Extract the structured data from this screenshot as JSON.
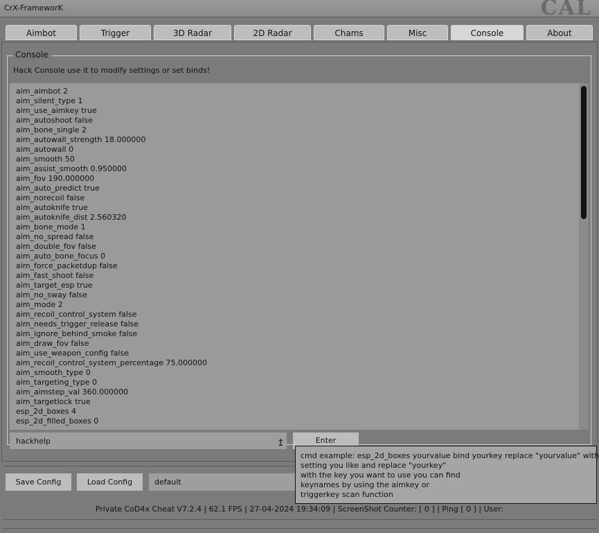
{
  "window": {
    "title": "CrX-FrameworK",
    "logo_text": "CAL"
  },
  "tabs": [
    {
      "label": "Aimbot"
    },
    {
      "label": "Trigger"
    },
    {
      "label": "3D Radar"
    },
    {
      "label": "2D Radar"
    },
    {
      "label": "Chams"
    },
    {
      "label": "Misc"
    },
    {
      "label": "Console",
      "active": true
    },
    {
      "label": "About"
    }
  ],
  "console": {
    "group_title": "Console",
    "description": "Hack Console use it to modify settings or set binds!",
    "lines": [
      "aim_aimbot 2",
      "aim_silent_type 1",
      "aim_use_aimkey true",
      "aim_autoshoot false",
      "aim_bone_single 2",
      "aim_autowall_strength 18.000000",
      "aim_autowall 0",
      "aim_smooth 50",
      "aim_assist_smooth 0.950000",
      "aim_fov 190.000000",
      "aim_auto_predict true",
      "aim_norecoil false",
      "aim_autoknife true",
      "aim_autoknife_dist 2.560320",
      "aim_bone_mode 1",
      "aim_no_spread false",
      "aim_double_fov false",
      "aim_auto_bone_focus 0",
      "aim_force_packetdup false",
      "aim_fast_shoot false",
      "aim_target_esp true",
      "aim_no_sway false",
      "aim_mode 2",
      "aim_recoil_control_system false",
      "aim_needs_trigger_release false",
      "aim_ignore_behind_smoke false",
      "aim_draw_fov false",
      "aim_use_weapon_config false",
      "aim_recoil_control_system_percentage 75.000000",
      "aim_smooth_type 0",
      "aim_targeting_type 0",
      "aim_aimstep_val 360.000000",
      "aim_targetlock true",
      "esp_2d_boxes 4",
      "esp_2d_filled_boxes 0"
    ],
    "input_value": "hackhelp",
    "enter_label": "Enter",
    "tooltip_lines": [
      "cmd example: esp_2d_boxes yourvalue bind yourkey replace \"yourvalue\" with the",
      "setting you like and replace \"yourkey\"",
      "with the key you want to use you can find",
      "keynames by using the aimkey or",
      "triggerkey scan function"
    ]
  },
  "config": {
    "save_label": "Save Config",
    "load_label": "Load Config",
    "name_value": "default"
  },
  "status": {
    "text": "Private CoD4x Cheat V7.2.4  | 62.1 FPS |   27-04-2024 19:34:09  | ScreenShot Counter: [ 0 ] | Ping [ 0 ] | User:"
  }
}
